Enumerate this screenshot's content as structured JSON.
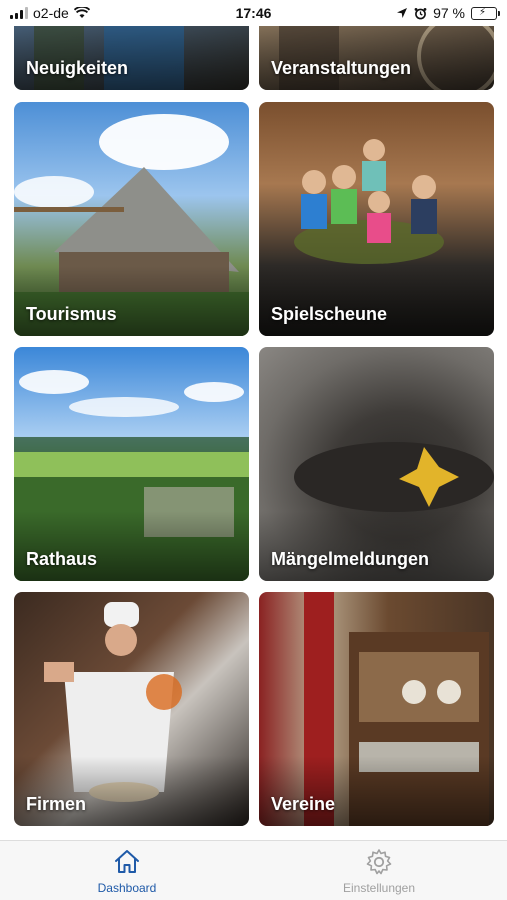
{
  "status_bar": {
    "carrier": "o2-de",
    "time": "17:46",
    "battery_percent": "97 %",
    "battery_level": 0.97,
    "icons": [
      "signal-icon",
      "wifi-icon",
      "location-icon",
      "alarm-icon",
      "battery-charging-icon"
    ]
  },
  "tiles": [
    {
      "label": "Neuigkeiten"
    },
    {
      "label": "Veranstaltungen"
    },
    {
      "label": "Tourismus"
    },
    {
      "label": "Spielscheune"
    },
    {
      "label": "Rathaus"
    },
    {
      "label": "Mängelmeldungen"
    },
    {
      "label": "Firmen"
    },
    {
      "label": "Vereine"
    }
  ],
  "tabbar": {
    "dashboard_label": "Dashboard",
    "settings_label": "Einstellungen",
    "active_color": "#1f5aa8",
    "inactive_color": "#a0a0a0"
  }
}
